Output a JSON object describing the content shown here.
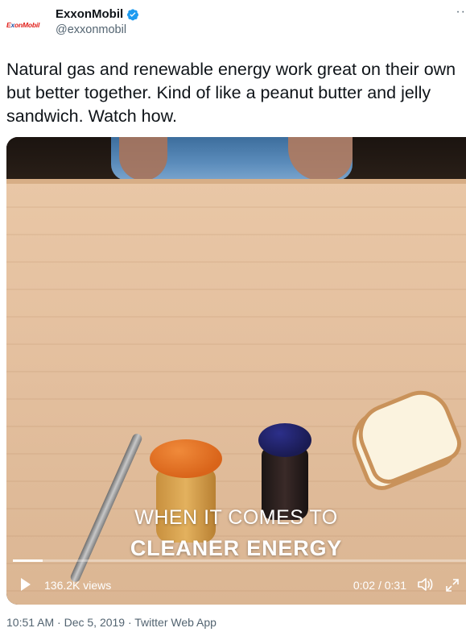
{
  "author": {
    "avatar_text_a": "E",
    "avatar_text_x": "x",
    "avatar_text_b": "onMobil",
    "display_name": "ExxonMobil",
    "handle": "@exxonmobil",
    "verified": true
  },
  "menu": {
    "more_label": "··"
  },
  "tweet": {
    "text": "Natural gas and renewable energy work great on their own but better together. Kind of like a peanut butter and jelly sandwich. Watch how."
  },
  "video": {
    "caption_line1": "WHEN IT COMES TO",
    "caption_line2": "CLEANER ENERGY",
    "views": "136.2K views",
    "time": "0:02 / 0:31",
    "progress": 0.065
  },
  "meta": {
    "timestamp": "10:51 AM · Dec 5, 2019 · Twitter Web App"
  },
  "icons": [
    "verified-badge-icon",
    "more-icon",
    "play-icon",
    "volume-icon",
    "fullscreen-icon"
  ],
  "colors": {
    "brand_red": "#e0201b",
    "verified_blue": "#1d9bf0",
    "secondary_text": "#536471"
  }
}
